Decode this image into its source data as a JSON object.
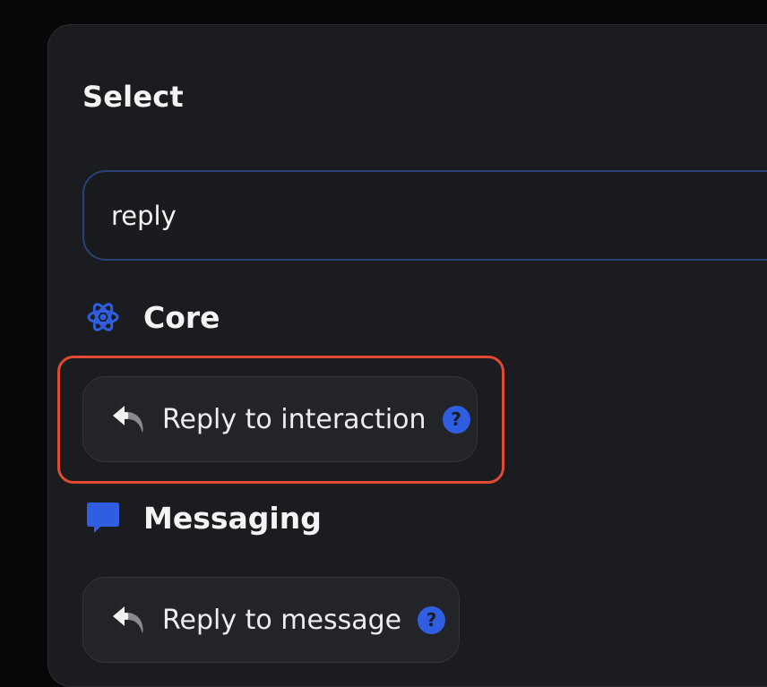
{
  "dialog": {
    "title": "Select"
  },
  "search": {
    "value": "reply"
  },
  "categories": [
    {
      "label": "Core",
      "icon": "atom-icon",
      "items": [
        {
          "label": "Reply to interaction",
          "help": "?",
          "icon": "reply-icon",
          "highlighted": true
        }
      ]
    },
    {
      "label": "Messaging",
      "icon": "message-bubble-icon",
      "items": [
        {
          "label": "Reply to message",
          "help": "?",
          "icon": "reply-icon",
          "highlighted": false
        }
      ]
    }
  ],
  "colors": {
    "accent": "#2f5fe0",
    "highlight_border": "#e34a33",
    "panel": "#1b1c1f",
    "chip": "#232428"
  }
}
